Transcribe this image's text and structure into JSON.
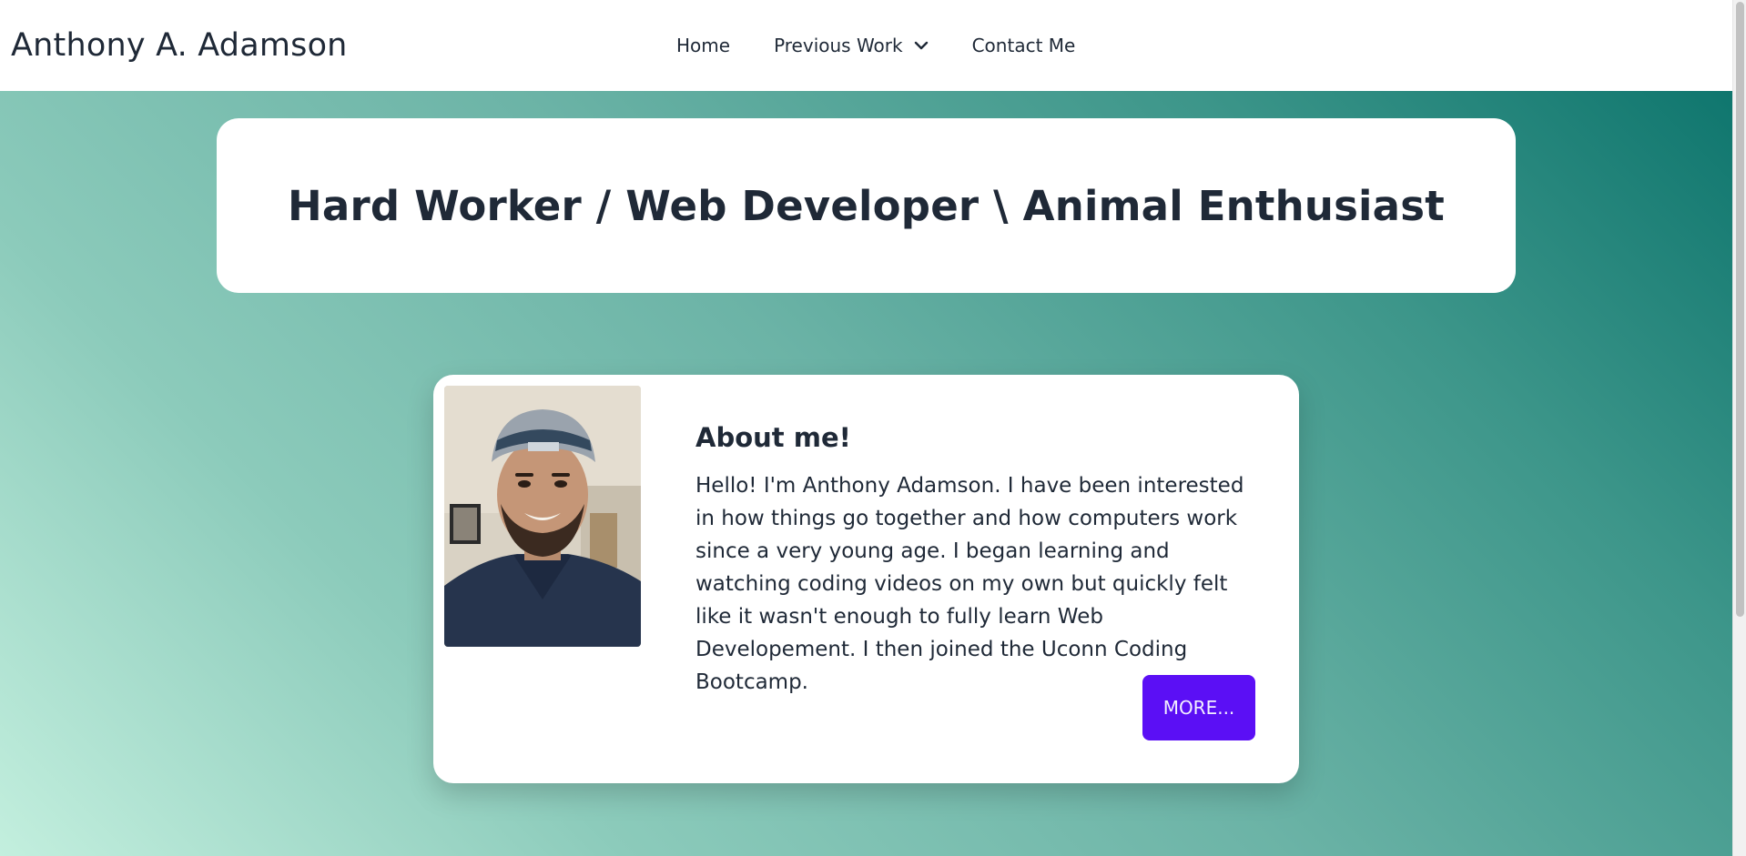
{
  "brand": "Anthony A. Adamson",
  "nav": {
    "home": "Home",
    "previous_work": "Previous Work",
    "contact": "Contact Me"
  },
  "hero": {
    "title": "Hard Worker / Web Developer \\ Animal Enthusiast"
  },
  "about": {
    "title": "About me!",
    "text": "Hello! I'm Anthony Adamson. I have been interested in how things go together and how computers work since a very young age. I began learning and watching coding videos on my own but quickly felt like it wasn't enough to fully learn Web Developement. I then joined the Uconn Coding Bootcamp.",
    "button": "MORE..."
  },
  "colors": {
    "accent_button": "#5b0ff5",
    "gradient_dark": "#0f766e",
    "gradient_light": "#c3efde"
  },
  "icons": {
    "dropdown": "chevron-down-icon"
  }
}
